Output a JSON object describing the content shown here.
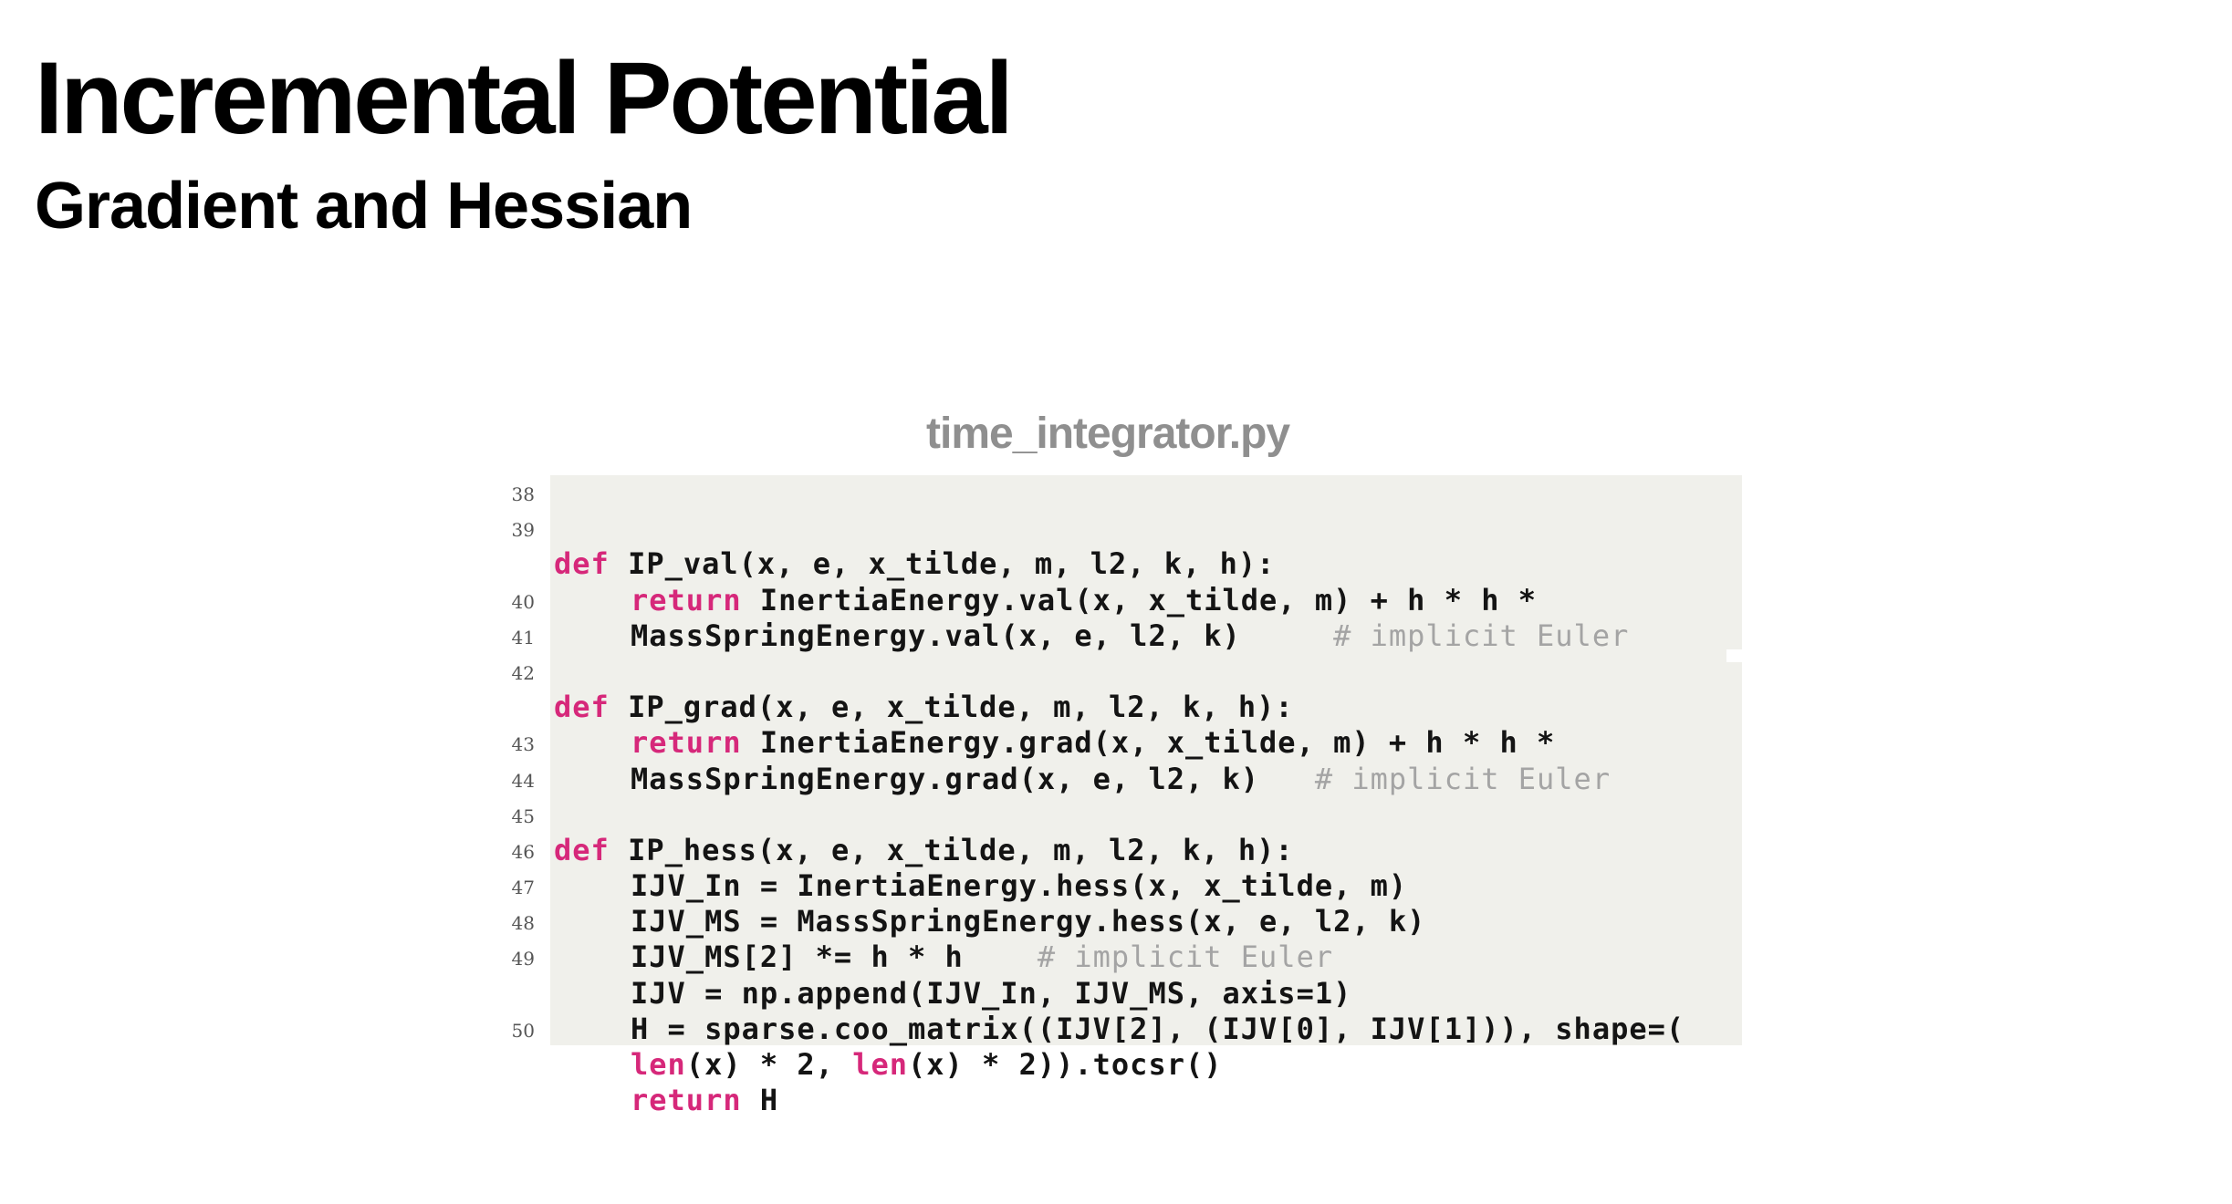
{
  "slide": {
    "title": "Incremental Potential",
    "subtitle": "Gradient and Hessian"
  },
  "code_block": {
    "file_name": "time_integrator.py",
    "lines": [
      {
        "number": "38",
        "keyword": "def",
        "text": " IP_val(x, e, x_tilde, m, l2, k, h):",
        "comment": ""
      },
      {
        "number": "39",
        "keyword": "return",
        "text": " InertiaEnergy.val(x, x_tilde, m) + h * h *",
        "comment": ""
      },
      {
        "number": "",
        "keyword": "",
        "text": "MassSpringEnergy.val(x, e, l2, k)     ",
        "comment": "# implicit Euler"
      },
      {
        "number": "40",
        "keyword": "",
        "text": "",
        "comment": ""
      },
      {
        "number": "41",
        "keyword": "def",
        "text": " IP_grad(x, e, x_tilde, m, l2, k, h):",
        "comment": ""
      },
      {
        "number": "42",
        "keyword": "return",
        "text": " InertiaEnergy.grad(x, x_tilde, m) + h * h *",
        "comment": ""
      },
      {
        "number": "",
        "keyword": "",
        "text": "MassSpringEnergy.grad(x, e, l2, k)   ",
        "comment": "# implicit Euler"
      },
      {
        "number": "43",
        "keyword": "",
        "text": "",
        "comment": ""
      },
      {
        "number": "44",
        "keyword": "def",
        "text": " IP_hess(x, e, x_tilde, m, l2, k, h):",
        "comment": ""
      },
      {
        "number": "45",
        "keyword": "",
        "text": "IJV_In = InertiaEnergy.hess(x, x_tilde, m)",
        "comment": ""
      },
      {
        "number": "46",
        "keyword": "",
        "text": "IJV_MS = MassSpringEnergy.hess(x, e, l2, k)",
        "comment": ""
      },
      {
        "number": "47",
        "keyword": "",
        "text": "IJV_MS[2] *= h * h    ",
        "comment": "# implicit Euler"
      },
      {
        "number": "48",
        "keyword": "",
        "text": "IJV = np.append(IJV_In, IJV_MS, axis=1)",
        "comment": ""
      },
      {
        "number": "49",
        "keyword": "",
        "text": "H = sparse.coo_matrix((IJV[2], (IJV[0], IJV[1])), shape=(",
        "comment": ""
      },
      {
        "number": "",
        "keyword": "len",
        "text": "(x) * 2, ",
        "keyword2": "len",
        "text2": "(x) * 2)).tocsr()",
        "comment": ""
      },
      {
        "number": "50",
        "keyword": "return",
        "text": " H",
        "comment": ""
      }
    ]
  }
}
